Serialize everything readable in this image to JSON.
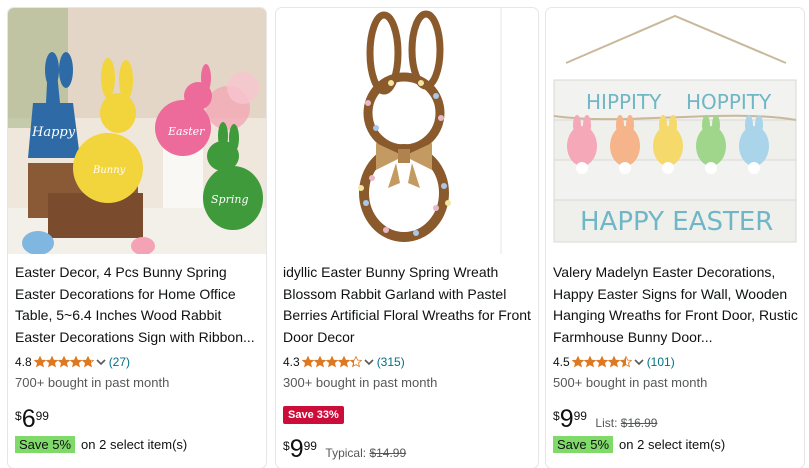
{
  "products": [
    {
      "title": "Easter Decor, 4 Pcs Bunny Spring Easter Decorations for Home Office Table, 5~6.4 Inches Wood Rabbit Easter Decorations Sign with Ribbon...",
      "rating": "4.8",
      "rating_stars": 4.8,
      "reviews": "(27)",
      "bought": "700+ bought in past month",
      "price_symbol": "$",
      "price_whole": "6",
      "price_fraction": "99",
      "save_badge": "Save 5%",
      "save_text": "on 2 select item(s)",
      "image_texts": [
        "Happy",
        "Bunny",
        "Easter",
        "Spring"
      ]
    },
    {
      "title": "idyllic Easter Bunny Spring Wreath Blossom Rabbit Garland with Pastel Berries Artificial Floral Wreaths for Front Door Decor",
      "rating": "4.3",
      "rating_stars": 4.3,
      "reviews": "(315)",
      "bought": "300+ bought in past month",
      "deal_badge": "Save 33%",
      "price_symbol": "$",
      "price_whole": "9",
      "price_fraction": "99",
      "typical_label": "Typical:",
      "typical_price": "$14.99"
    },
    {
      "title": "Valery Madelyn Easter Decorations, Happy Easter Signs for Wall, Wooden Hanging Wreaths for Front Door, Rustic Farmhouse Bunny Door...",
      "rating": "4.5",
      "rating_stars": 4.5,
      "reviews": "(101)",
      "bought": "500+ bought in past month",
      "price_symbol": "$",
      "price_whole": "9",
      "price_fraction": "99",
      "list_label": "List:",
      "list_price": "$16.99",
      "save_badge": "Save 5%",
      "save_text": "on 2 select item(s)",
      "image_texts": [
        "HIPPITY",
        "HOPPITY",
        "HAPPY EASTER"
      ]
    }
  ],
  "colors": {
    "star": "#de7921",
    "link": "#007185",
    "save_badge_bg": "#7fda69",
    "deal_badge_bg": "#cc0c39"
  }
}
